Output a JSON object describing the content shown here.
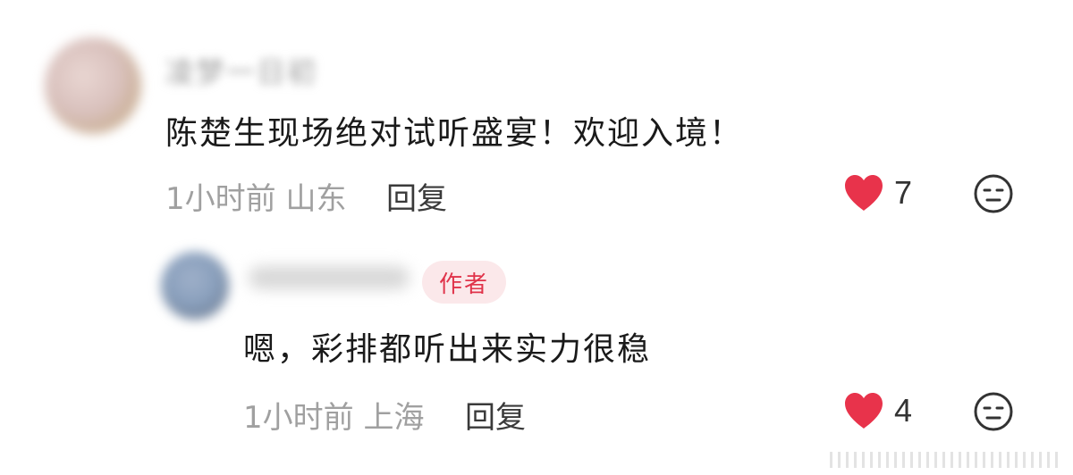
{
  "comments": [
    {
      "author": "凌梦一日初",
      "content": "陈楚生现场绝对试听盛宴！欢迎入境！",
      "time": "1小时前",
      "location": "山东",
      "reply_label": "回复",
      "likes": "7"
    }
  ],
  "reply": {
    "author_badge": "作者",
    "content": "嗯，彩排都听出来实力很稳",
    "time": "1小时前",
    "location": "上海",
    "reply_label": "回复",
    "likes": "4"
  },
  "colors": {
    "like_heart": "#e8334b",
    "badge_bg": "#fbe8ea",
    "badge_text": "#e0334a",
    "meta_text": "#a0a0a0"
  },
  "icons": {
    "like": "heart-icon",
    "emoji": "neutral-face-icon"
  }
}
